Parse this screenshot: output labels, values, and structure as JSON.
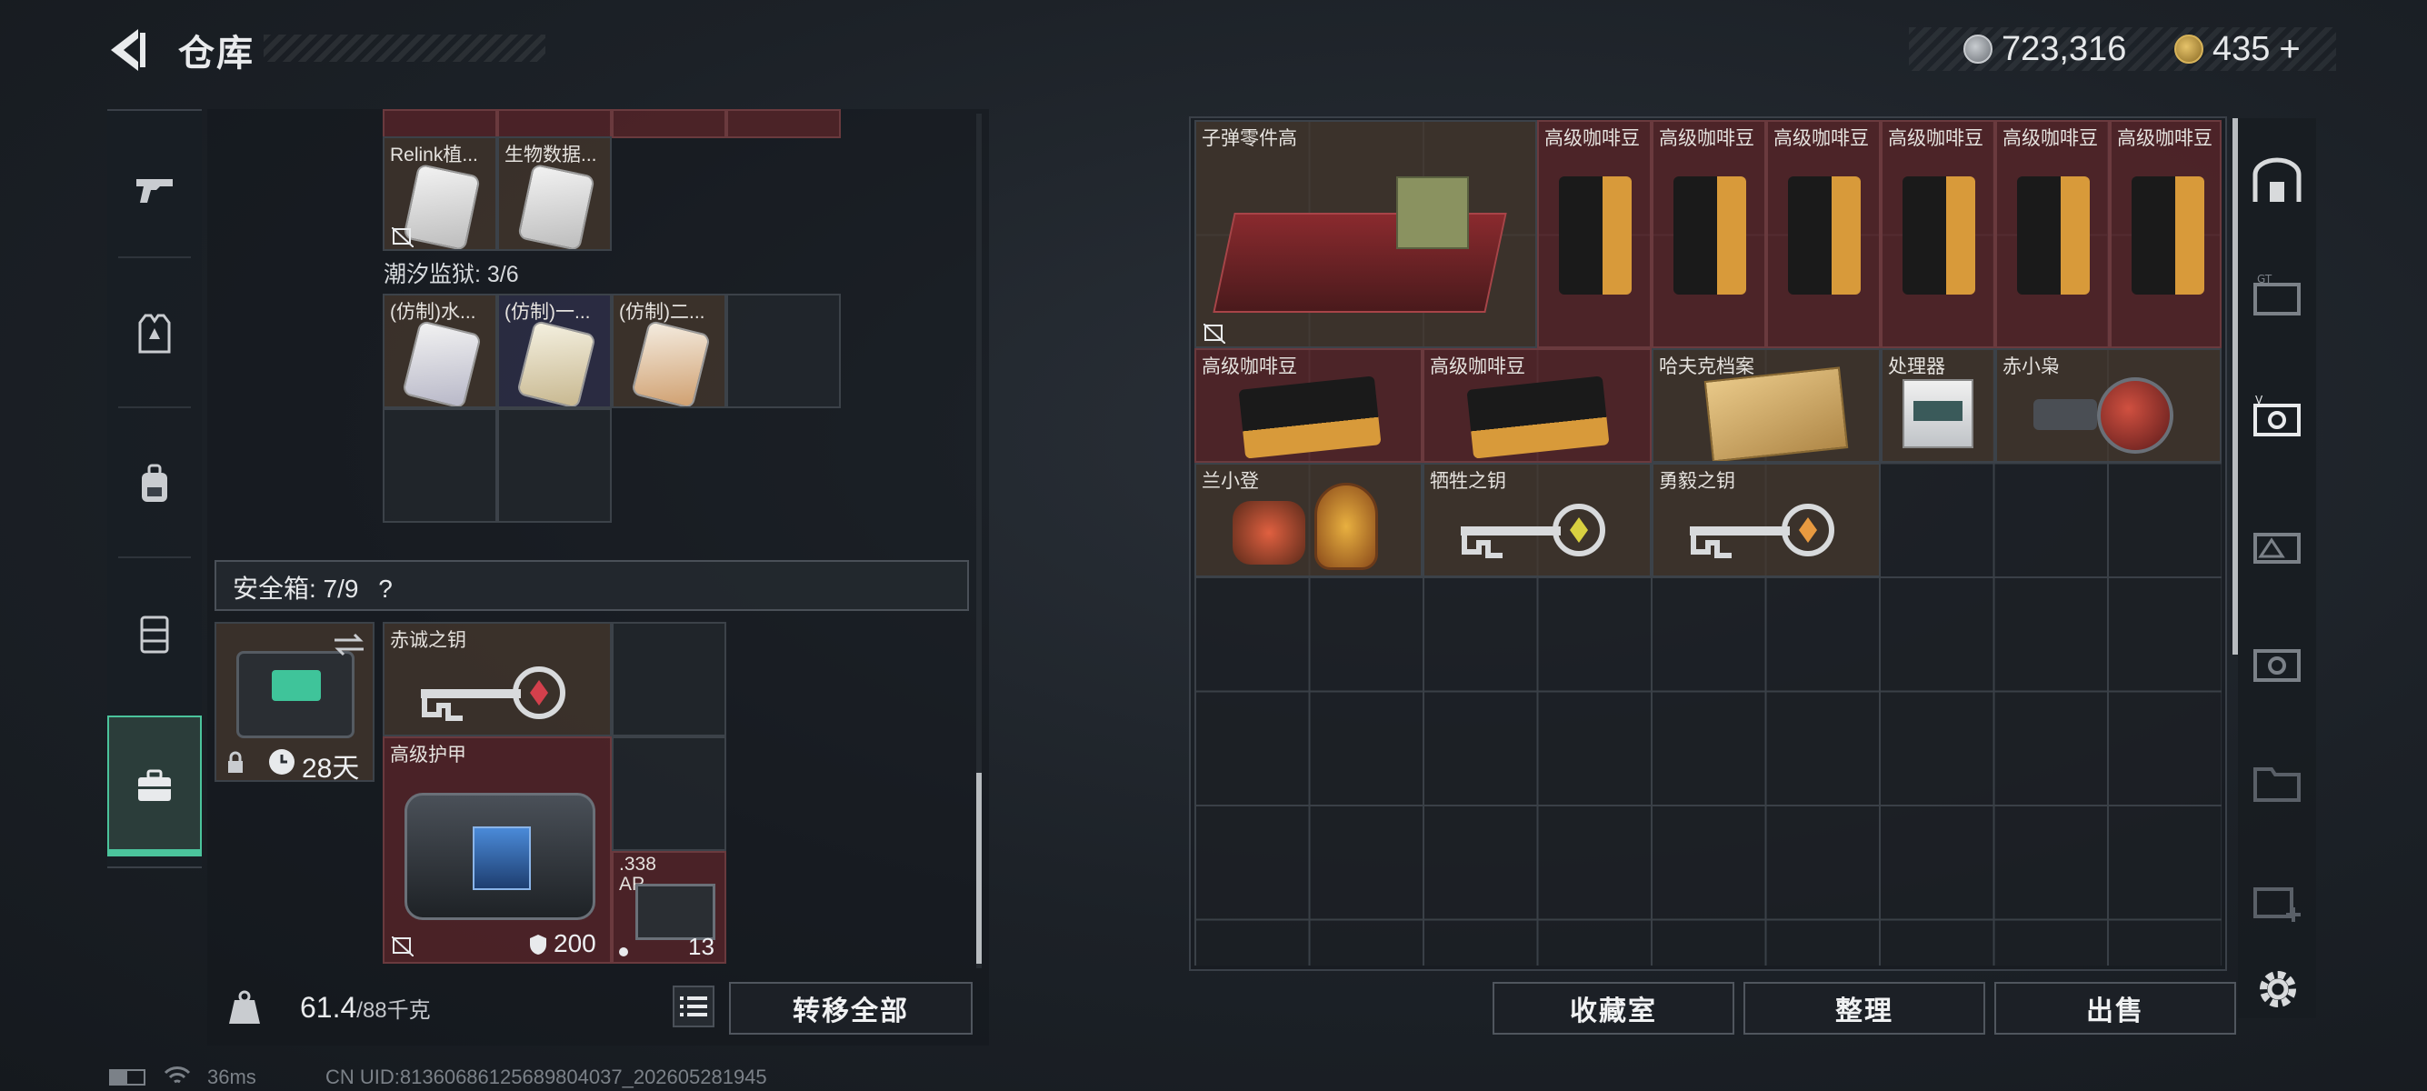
{
  "header": {
    "title": "仓库"
  },
  "currency": {
    "silver": "723,316",
    "gold": "435",
    "gold_add": "+"
  },
  "top_section": {
    "items": [
      {
        "label": "Relink植..."
      },
      {
        "label": "生物数据..."
      }
    ]
  },
  "tide_prison": {
    "label": "潮汐监狱: 3/6",
    "items": [
      {
        "label": "(仿制)水..."
      },
      {
        "label": "(仿制)一..."
      },
      {
        "label": "(仿制)二..."
      }
    ]
  },
  "safebox": {
    "label": "安全箱: 7/9",
    "help": "?",
    "duration": "28天",
    "items": [
      {
        "label": "赤诚之钥"
      },
      {
        "label": "高级护甲",
        "durability": "200"
      },
      {
        "label": ".338 AP",
        "count": "13"
      }
    ]
  },
  "weight": {
    "current": "61.4",
    "max": "/88千克"
  },
  "buttons": {
    "transfer_all": "转移全部",
    "collection": "收藏室",
    "organize": "整理",
    "sell": "出售"
  },
  "stash": {
    "items": [
      {
        "label": "子弹零件高"
      },
      {
        "label": "高级咖啡豆"
      },
      {
        "label": "高级咖啡豆"
      },
      {
        "label": "高级咖啡豆"
      },
      {
        "label": "高级咖啡豆"
      },
      {
        "label": "高级咖啡豆"
      },
      {
        "label": "高级咖啡豆"
      },
      {
        "label": "高级咖啡豆"
      },
      {
        "label": "高级咖啡豆"
      },
      {
        "label": "哈夫克档案"
      },
      {
        "label": "处理器"
      },
      {
        "label": "赤小枭"
      },
      {
        "label": "兰小登"
      },
      {
        "label": "牺牲之钥"
      },
      {
        "label": "勇毅之钥"
      }
    ]
  },
  "status_bar": {
    "ping": "36ms",
    "uid": "CN UID:81360686125689804037_202605281945"
  },
  "colors": {
    "accent": "#4bc49c",
    "red_cell": "#5c262a"
  }
}
